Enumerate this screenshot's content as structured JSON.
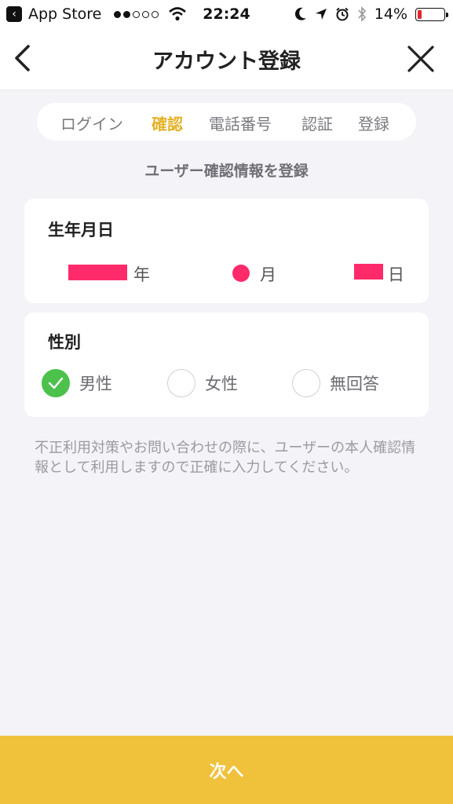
{
  "status_bar": {
    "back_app_label": "App Store",
    "time": "22:24",
    "battery_percent": "14%",
    "battery_color": "#e3262c"
  },
  "nav": {
    "title": "アカウント登録",
    "back_icon": "chevron-left-icon",
    "close_icon": "close-icon"
  },
  "steps": [
    {
      "label": "ログイン",
      "active": false
    },
    {
      "label": "確認",
      "active": true
    },
    {
      "label": "電話番号",
      "active": false
    },
    {
      "label": "認証",
      "active": false
    },
    {
      "label": "登録",
      "active": false
    }
  ],
  "subtitle": "ユーザー確認情報を登録",
  "birthday": {
    "title": "生年月日",
    "year_unit": "年",
    "month_unit": "月",
    "day_unit": "日"
  },
  "gender": {
    "title": "性別",
    "options": [
      {
        "label": "男性",
        "checked": true
      },
      {
        "label": "女性",
        "checked": false
      },
      {
        "label": "無回答",
        "checked": false
      }
    ]
  },
  "notice": "不正利用対策やお問い合わせの際に、ユーザーの本人確認情報として利用しますので正確に入力してください。",
  "next_button": "次へ",
  "colors": {
    "accent": "#e3b227",
    "button": "#f0c13b",
    "check": "#4cc14c",
    "redaction": "#ff2a6a"
  }
}
